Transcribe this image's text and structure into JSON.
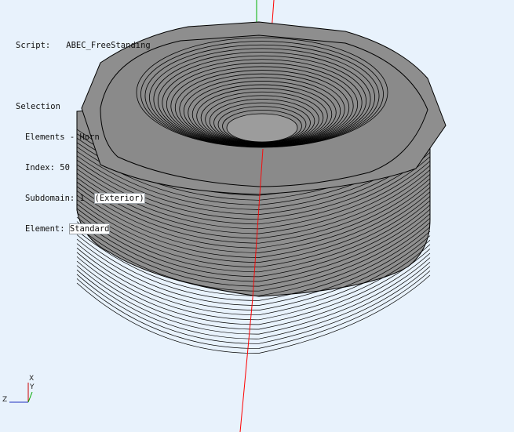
{
  "info": {
    "script_label": "Script:",
    "script_value": "ABEC_FreeStanding",
    "selection_label": "Selection",
    "elements": "Elements - Horn",
    "index": "Index: 50",
    "subdomain_prefix": "Subdomain: 1",
    "subdomain_highlight": "(Exterior)",
    "element_prefix": "Element: ",
    "element_highlight": "Standard"
  },
  "triad": {
    "x_label": "X",
    "y_label": "Y",
    "z_label": "Z"
  },
  "colors": {
    "background": "#e8f2fc",
    "mesh_fill": "#8a8a8a",
    "mesh_lines": "#000000",
    "axis_x": "#ff0000",
    "axis_y": "#00b000",
    "triad_x": "#cc0000",
    "triad_y": "#00aa00"
  }
}
